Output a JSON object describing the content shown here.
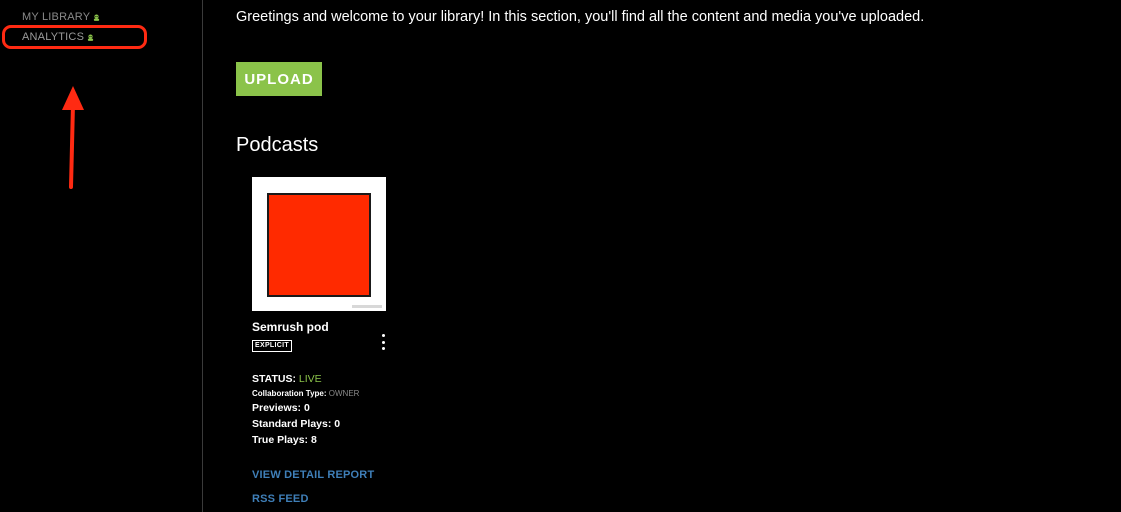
{
  "sidebar": {
    "items": [
      {
        "label": "MY LIBRARY",
        "icon": "user-badge-icon"
      },
      {
        "label": "ANALYTICS",
        "icon": "user-badge-icon"
      }
    ]
  },
  "main": {
    "greeting": "Greetings and welcome to your library! In this section, you'll find all the content and media you've uploaded.",
    "upload_label": "UPLOAD",
    "section_title": "Podcasts",
    "podcast": {
      "name": "Semrush pod",
      "explicit_label": "EXPLICIT",
      "status_label": "STATUS:",
      "status_value": "LIVE",
      "collab_label": "Collaboration Type:",
      "collab_value": "OWNER",
      "previews": "Previews: 0",
      "standard_plays": "Standard Plays: 0",
      "true_plays": "True Plays: 8",
      "detail_report_link": "VIEW DETAIL REPORT",
      "rss_link": "RSS FEED"
    }
  },
  "colors": {
    "accent_green": "#8bc34a",
    "link_blue": "#3f7fb8",
    "annotation_red": "#ff2a12",
    "thumb_red": "#ff2a00"
  }
}
